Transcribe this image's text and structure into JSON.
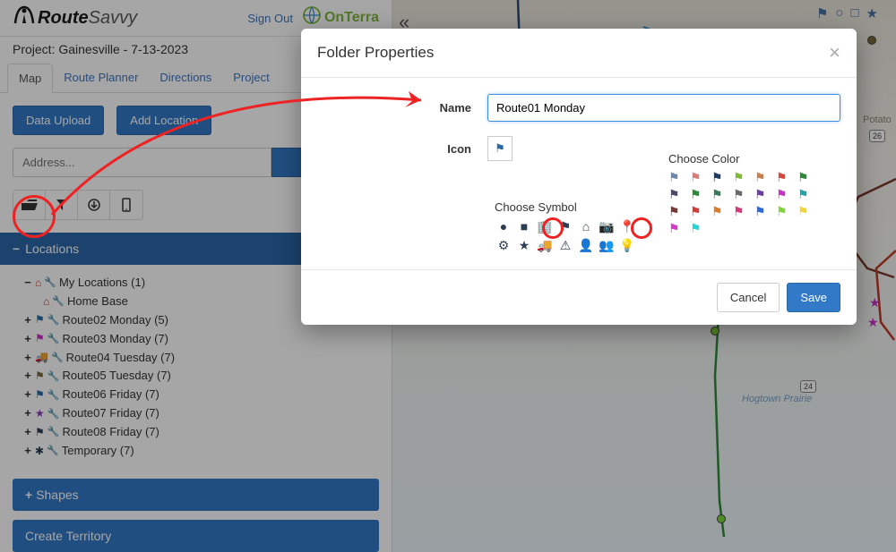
{
  "header": {
    "brand_route": "Route",
    "brand_savvy": "Savvy",
    "signout": "Sign Out",
    "partner": "OnTerra"
  },
  "project_label": "Project: Gainesville - 7-13-2023",
  "tabs": {
    "map": "Map",
    "route_planner": "Route Planner",
    "directions": "Directions",
    "project": "Project"
  },
  "toolbar": {
    "data_upload": "Data Upload",
    "add_location": "Add Location"
  },
  "address": {
    "placeholder": "Address..."
  },
  "panels": {
    "locations": "Locations",
    "shapes": "Shapes",
    "create_territory": "Create Territory"
  },
  "tree": {
    "my_locations": "My Locations (1)",
    "home_base": "Home Base",
    "items": [
      {
        "label": "Route02 Monday (5)",
        "color": "#2a6aa3"
      },
      {
        "label": "Route03 Monday (7)",
        "color": "#c732c3"
      },
      {
        "label": "Route04 Tuesday (7)",
        "color": "#1f6b2e"
      },
      {
        "label": "Route05 Tuesday (7)",
        "color": "#7a6a3a"
      },
      {
        "label": "Route06 Friday (7)",
        "color": "#2a6aa3"
      },
      {
        "label": "Route07 Friday (7)",
        "color": "#8a3fb5"
      },
      {
        "label": "Route08 Friday (7)",
        "color": "#2c3e55"
      },
      {
        "label": "Temporary (7)",
        "color": "#2c3e55"
      }
    ]
  },
  "modal": {
    "title": "Folder Properties",
    "name_label": "Name",
    "name_value": "Route01 Monday",
    "icon_label": "Icon",
    "choose_symbol": "Choose Symbol",
    "choose_color": "Choose Color",
    "cancel": "Cancel",
    "save": "Save",
    "colors_row1": [
      "#6b88a8",
      "#d97b7b",
      "#1f3a64",
      "#7fb83a",
      "#c97f4a",
      "#d4473a",
      "#2e8a3a"
    ],
    "colors_row2": [
      "#4a4a6a",
      "#2e8a3a",
      "#3a7a5a",
      "#6a6a6a",
      "#6a3fa5",
      "#c732c3",
      "#2aa0a8"
    ],
    "colors_row3": [
      "#7a3a3a",
      "#d43a3a",
      "#d97b2a",
      "#d43a7a",
      "#2a6add",
      "#7fd43a",
      "#f5d43a"
    ],
    "colors_row4": [
      "#d43ac7",
      "#2ad4d4"
    ]
  },
  "map": {
    "hogtown": "Hogtown Prairie",
    "potato": "Potato",
    "road24": "24",
    "road26": "26"
  }
}
